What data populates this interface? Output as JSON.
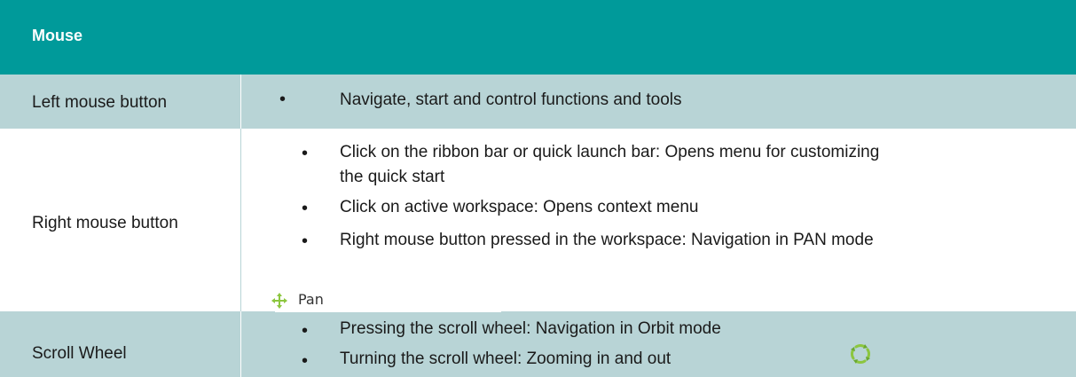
{
  "header": {
    "title": "Mouse"
  },
  "rows": [
    {
      "label": "Left mouse button",
      "bullets": [
        "Navigate, start and control functions and tools"
      ]
    },
    {
      "label": "Right mouse button",
      "bullets": [
        "Click on the ribbon bar or quick launch bar: Opens menu for customizing",
        "the quick start",
        "Click on active workspace: Opens context menu",
        "Right mouse button pressed in the workspace: Navigation in PAN mode"
      ],
      "pan_label": "Pan",
      "pan_icon": "pan-move-arrows-icon"
    },
    {
      "label": "Scroll  Wheel",
      "bullets": [
        "Pressing the scroll wheel: Navigation in Orbit mode",
        "Turning the scroll wheel: Zooming in and out"
      ],
      "orbit_icon": "orbit-arrows-icon"
    }
  ],
  "colors": {
    "header_bg": "#009a9a",
    "shaded_row_bg": "#b8d4d6",
    "icon_green": "#8cc63f"
  }
}
